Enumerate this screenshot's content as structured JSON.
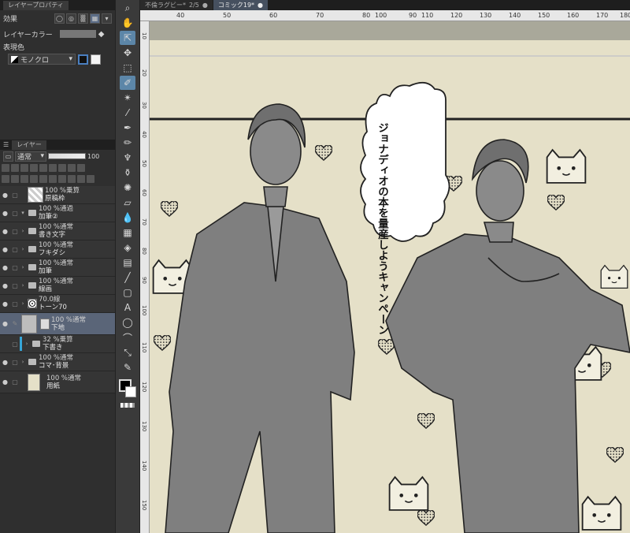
{
  "left_panel": {
    "property_tab": "レイヤープロパティ",
    "effect_label": "効果",
    "layer_color_label": "レイヤーカラー",
    "expression_label": "表現色",
    "expression_value": "モノクロ",
    "layer_tab": "レイヤー",
    "blend_mode": "通常",
    "opacity": "100",
    "layers": [
      {
        "mode": "100 %乗算",
        "name": "原稿枠",
        "type": "layer",
        "selected": false
      },
      {
        "mode": "100 %通過",
        "name": "加筆②",
        "type": "folder",
        "selected": false
      },
      {
        "mode": "100 %通常",
        "name": "書き文字",
        "type": "folder",
        "selected": false
      },
      {
        "mode": "100 %通常",
        "name": "フキダシ",
        "type": "folder",
        "selected": false
      },
      {
        "mode": "100 %通常",
        "name": "加筆",
        "type": "folder",
        "selected": false
      },
      {
        "mode": "100 %通常",
        "name": "線画",
        "type": "folder",
        "selected": false
      },
      {
        "mode": "70.0線",
        "name": "トーン70",
        "type": "tone",
        "selected": false
      },
      {
        "mode": "100 %通常",
        "name": "下地",
        "type": "layer",
        "selected": true
      },
      {
        "mode": "32 %乗算",
        "name": "下書き",
        "type": "folder",
        "selected": false
      },
      {
        "mode": "100 %通常",
        "name": "コマ･背景",
        "type": "folder",
        "selected": false
      },
      {
        "mode": "100 %通常",
        "name": "用紙",
        "type": "paper",
        "selected": false
      }
    ]
  },
  "doc_tabs": [
    {
      "label": "不倫ラグビー*",
      "page": "2/5",
      "active": false
    },
    {
      "label": "コミック19*",
      "page": "",
      "active": true
    }
  ],
  "ruler": {
    "top_ticks": [
      "40",
      "50",
      "60",
      "70",
      "80",
      "90",
      "100",
      "110",
      "120",
      "130",
      "140",
      "150",
      "160",
      "170",
      "180"
    ],
    "left_ticks": [
      "10",
      "20",
      "30",
      "40",
      "50",
      "60",
      "70",
      "80",
      "90",
      "100",
      "110",
      "120",
      "130",
      "140",
      "150"
    ]
  },
  "canvas": {
    "speech_bubble_lines": [
      "ジョナディオの本を",
      "量産しよう",
      "キャンペーン"
    ]
  },
  "colors": {
    "paper": "#e5e0c8",
    "selected_layer": "#5a6578",
    "active_tool": "#5c86a8",
    "figure_fill": "#808080"
  }
}
